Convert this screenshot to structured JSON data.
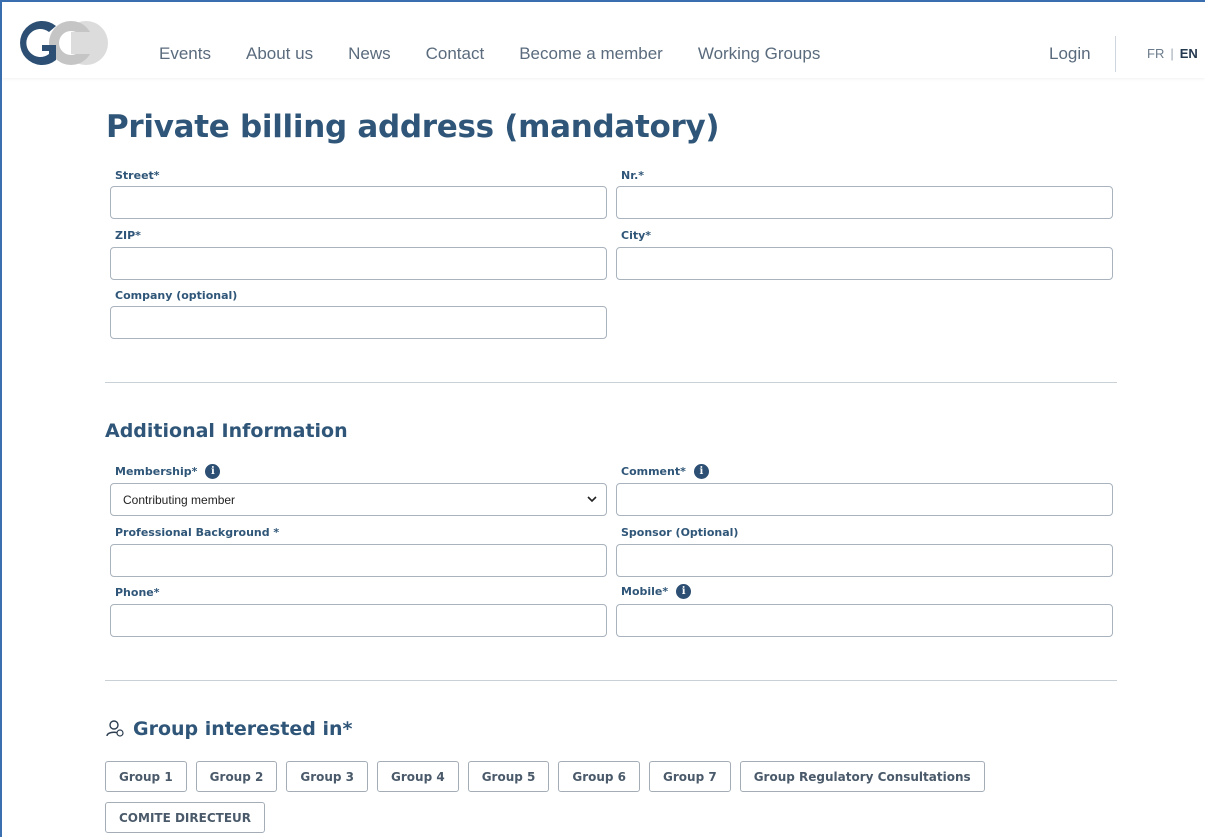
{
  "header": {
    "logo_text": "GC",
    "nav": [
      "Events",
      "About us",
      "News",
      "Contact",
      "Become a member",
      "Working Groups"
    ],
    "login": "Login",
    "lang_fr": "FR",
    "lang_sep": "|",
    "lang_en": "EN"
  },
  "billing": {
    "title": "Private billing address (mandatory)",
    "street_label": "Street*",
    "nr_label": "Nr.*",
    "zip_label": "ZIP*",
    "city_label": "City*",
    "company_label": "Company (optional)"
  },
  "additional": {
    "title": "Additional Information",
    "membership_label": "Membership*",
    "membership_value": "Contributing member",
    "comment_label": "Comment*",
    "professional_label": "Professional Background *",
    "sponsor_label": "Sponsor (Optional)",
    "phone_label": "Phone*",
    "mobile_label": "Mobile*",
    "info_glyph": "i"
  },
  "groups": {
    "title": "Group interested in*",
    "items": [
      "Group 1",
      "Group 2",
      "Group 3",
      "Group 4",
      "Group 5",
      "Group 6",
      "Group 7",
      "Group Regulatory Consultations"
    ],
    "items_row2": [
      "COMITE DIRECTEUR"
    ]
  },
  "colors": {
    "accent": "#2f5678",
    "nav_text": "#5a6b7d",
    "border": "#a9b3bd"
  }
}
